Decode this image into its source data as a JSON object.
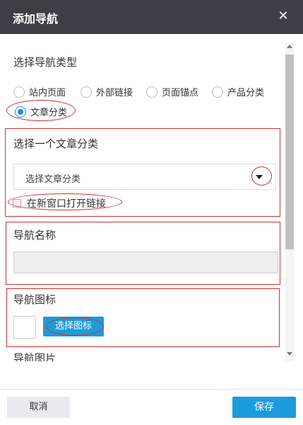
{
  "dialog": {
    "title": "添加导航",
    "close_symbol": "✕"
  },
  "nav_type": {
    "label": "选择导航类型",
    "options": [
      {
        "label": "站内页面",
        "selected": false
      },
      {
        "label": "外部链接",
        "selected": false
      },
      {
        "label": "页面锚点",
        "selected": false
      },
      {
        "label": "产品分类",
        "selected": false
      },
      {
        "label": "文章分类",
        "selected": true
      }
    ]
  },
  "article_category": {
    "label": "选择一个文章分类",
    "select_value": "选择文章分类",
    "new_window_label": "在新窗口打开链接",
    "new_window_checked": false
  },
  "nav_name": {
    "label": "导航名称",
    "value": ""
  },
  "nav_icon": {
    "label": "导航图标",
    "button_label": "选择图标"
  },
  "nav_image": {
    "label": "导航图片"
  },
  "footer": {
    "cancel_label": "取消",
    "save_label": "保存"
  },
  "colors": {
    "titlebar": "#3c3f45",
    "primary": "#1c9bdc",
    "annotation": "#d0312d"
  },
  "icons": {
    "close": "close-icon",
    "dropdown": "chevron-down-icon",
    "scroll_up": "arrow-up-icon",
    "scroll_down": "arrow-down-icon"
  }
}
